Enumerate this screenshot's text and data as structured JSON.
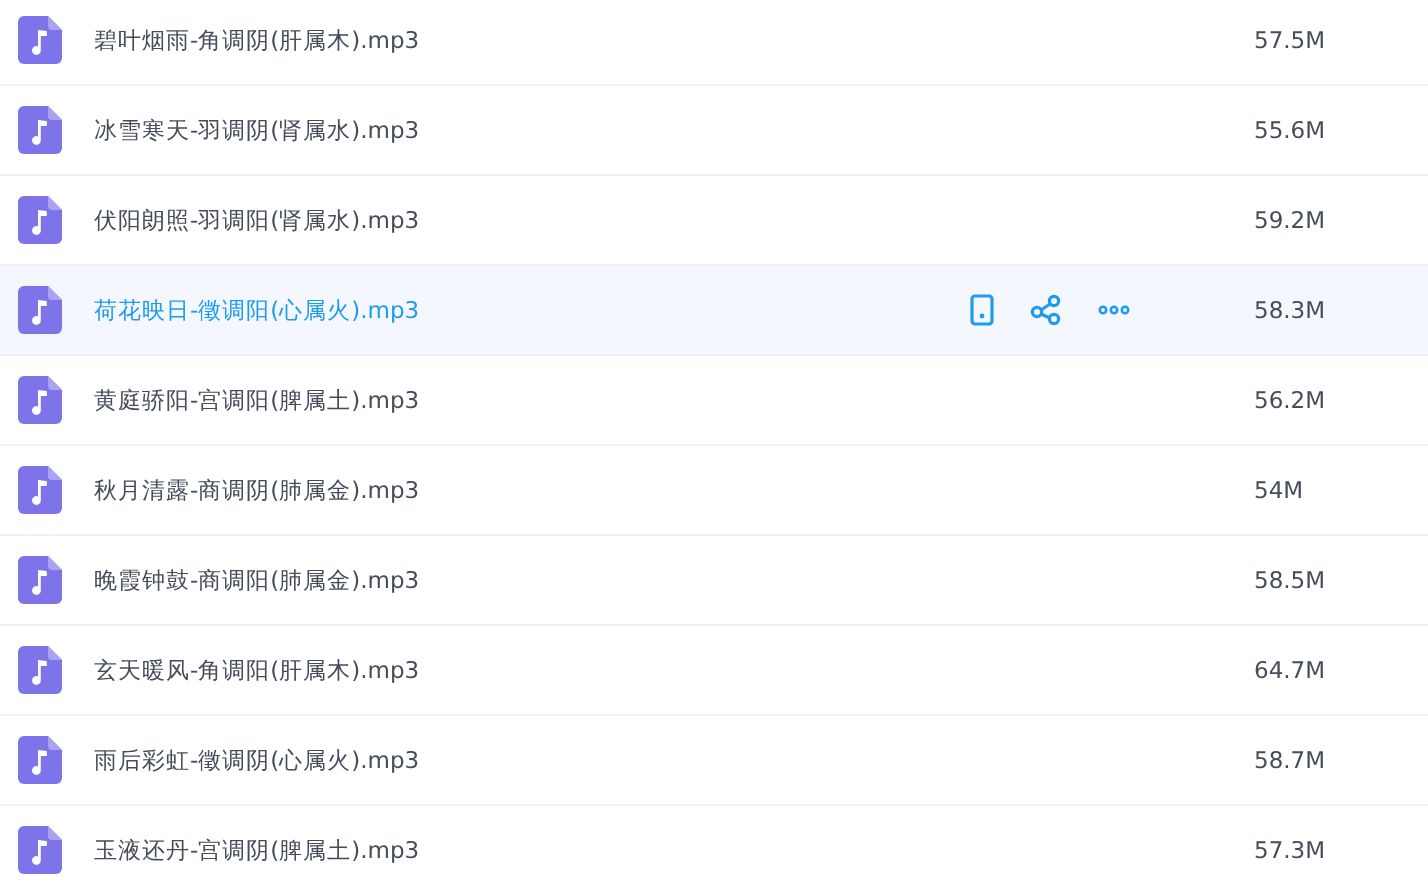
{
  "files": [
    {
      "name": "碧叶烟雨-角调阴(肝属木).mp3",
      "size": "57.5M",
      "selected": false
    },
    {
      "name": "冰雪寒天-羽调阴(肾属水).mp3",
      "size": "55.6M",
      "selected": false
    },
    {
      "name": "伏阳朗照-羽调阳(肾属水).mp3",
      "size": "59.2M",
      "selected": false
    },
    {
      "name": "荷花映日-徵调阳(心属火).mp3",
      "size": "58.3M",
      "selected": true
    },
    {
      "name": "黄庭骄阳-宫调阳(脾属土).mp3",
      "size": "56.2M",
      "selected": false
    },
    {
      "name": "秋月清露-商调阴(肺属金).mp3",
      "size": "54M",
      "selected": false
    },
    {
      "name": "晚霞钟鼓-商调阳(肺属金).mp3",
      "size": "58.5M",
      "selected": false
    },
    {
      "name": "玄天暖风-角调阳(肝属木).mp3",
      "size": "64.7M",
      "selected": false
    },
    {
      "name": "雨后彩虹-徵调阴(心属火).mp3",
      "size": "58.7M",
      "selected": false
    },
    {
      "name": "玉液还丹-宫调阴(脾属土).mp3",
      "size": "57.3M",
      "selected": false
    }
  ]
}
